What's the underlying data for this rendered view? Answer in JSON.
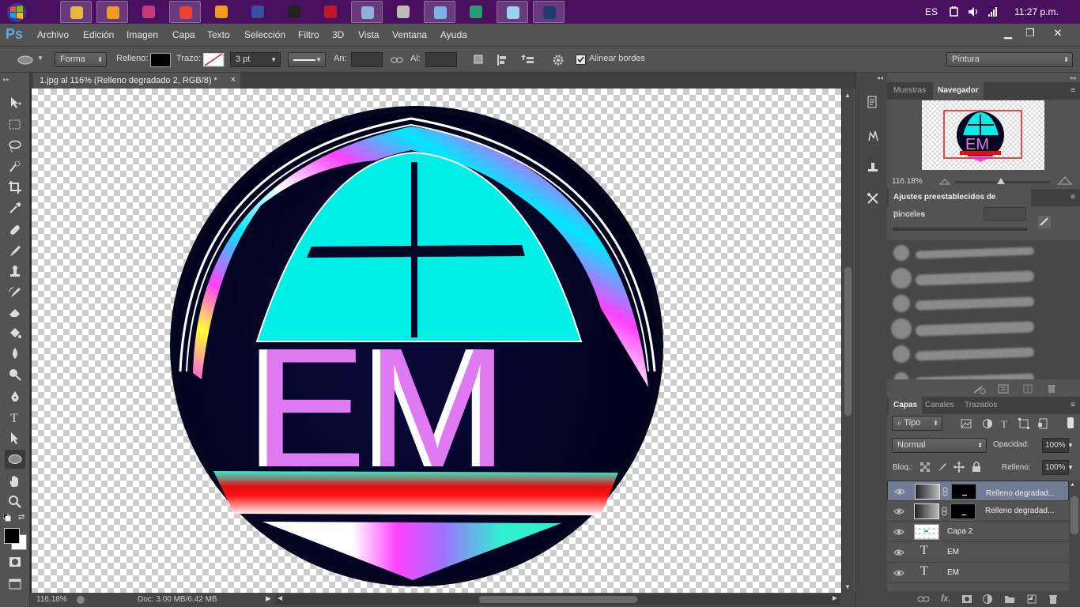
{
  "taskbar": {
    "apps": [
      {
        "name": "file-explorer-icon",
        "color": "#e7b83c",
        "active": true
      },
      {
        "name": "media-player-icon",
        "color": "#f29b23",
        "active": true
      },
      {
        "name": "paint-app-icon",
        "color": "#c23b7a",
        "active": false
      },
      {
        "name": "chrome-icon",
        "color": "#e94235",
        "active": true
      },
      {
        "name": "illustrator-icon",
        "color": "#f49a1c",
        "active": false
      },
      {
        "name": "premiere-icon",
        "color": "#3b4fa0",
        "active": false
      },
      {
        "name": "cutout-app-icon",
        "color": "#222222",
        "active": false
      },
      {
        "name": "record-app-icon",
        "color": "#c0182a",
        "active": false
      },
      {
        "name": "paint-palette-icon",
        "color": "#8fb0dd",
        "active": true
      },
      {
        "name": "usb-drive-icon",
        "color": "#bcbcbc",
        "active": false
      },
      {
        "name": "keyboard-icon",
        "color": "#7fb2e5",
        "active": true
      },
      {
        "name": "app-arrow-icon",
        "color": "#2a9c71",
        "active": false
      },
      {
        "name": "notepad-icon",
        "color": "#9ad3f0",
        "active": true
      },
      {
        "name": "photoshop-taskbar-icon",
        "color": "#1e3b70",
        "active": true
      }
    ],
    "language": "ES",
    "time": "11:27 p.m."
  },
  "menubar": {
    "logo": "Ps",
    "items": [
      "Archivo",
      "Edición",
      "Imagen",
      "Capa",
      "Texto",
      "Selección",
      "Filtro",
      "3D",
      "Vista",
      "Ventana",
      "Ayuda"
    ]
  },
  "options": {
    "mode": "Forma",
    "fill_label": "Relleno:",
    "stroke_label": "Trazo:",
    "stroke_width": "3 pt",
    "width_label": "An:",
    "height_label": "Al:",
    "align_edges": "Alinear bordes",
    "workspace": "Pintura"
  },
  "document": {
    "tab_title": "1.jpg al 116% (Relleno degradado 2, RGB/8) *",
    "close": "×"
  },
  "logo": {
    "letters": "EM"
  },
  "status": {
    "zoom": "116.18%",
    "doc": "Doc: 3.00 MB/6.42 MB"
  },
  "navigator": {
    "tabs": [
      "Muestras",
      "Navegador"
    ],
    "zoom": "116.18%"
  },
  "brushes": {
    "title": "Ajustes preestablecidos de pinceles",
    "size_label": "Tamaño:"
  },
  "layers": {
    "tabs": [
      "Capas",
      "Canales",
      "Trazados"
    ],
    "filter": "Tipo",
    "blend": "Normal",
    "opacity_label": "Opacidad:",
    "opacity": "100%",
    "lock_label": "Bloq.:",
    "fill_label": "Relleno:",
    "fill": "100%",
    "items": [
      {
        "name": "Relleno degradad...",
        "type": "gradient",
        "selected": true
      },
      {
        "name": "Relleno degradad...",
        "type": "gradient",
        "selected": false
      },
      {
        "name": "Capa 2",
        "type": "pixel",
        "selected": false
      },
      {
        "name": "EM",
        "type": "text",
        "selected": false
      },
      {
        "name": "EM",
        "type": "text",
        "selected": false
      }
    ]
  },
  "colors": {
    "taskbar": "#4a1060",
    "cyan": "#00f0e8",
    "magenta": "#ff40ff",
    "letter": "#e07af2",
    "navy": "#060626"
  }
}
